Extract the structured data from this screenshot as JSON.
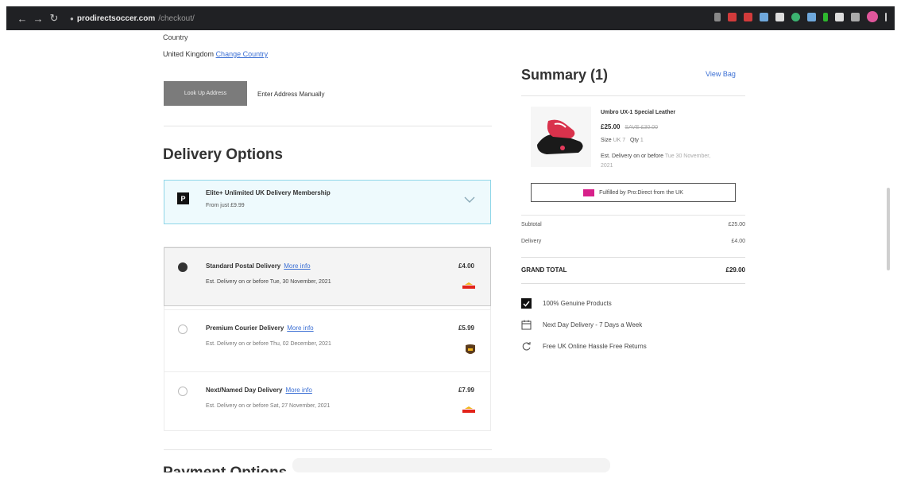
{
  "browser": {
    "url_domain": "prodirectsoccer.com",
    "url_path": "/checkout/"
  },
  "address": {
    "country_label": "Country",
    "country_value": "United Kingdom",
    "change_country": "Change Country",
    "lookup_button": "Look Up Address",
    "manual_link": "Enter Address Manually"
  },
  "delivery": {
    "title": "Delivery Options",
    "elite": {
      "title": "Elite+ Unlimited UK Delivery Membership",
      "subtitle": "From just £9.99"
    },
    "options": [
      {
        "name": "Standard Postal Delivery",
        "more_info": "More info",
        "estimate": "Est. Delivery on or before Tue, 30 November, 2021",
        "price": "£4.00",
        "selected": true,
        "carrier_icon": "royal-mail-icon"
      },
      {
        "name": "Premium Courier Delivery",
        "more_info": "More info",
        "estimate": "Est. Delivery on or before Thu, 02 December, 2021",
        "price": "£5.99",
        "selected": false,
        "carrier_icon": "ups-icon"
      },
      {
        "name": "Next/Named Day Delivery",
        "more_info": "More info",
        "estimate": "Est. Delivery on or before Sat, 27 November, 2021",
        "price": "£7.99",
        "selected": false,
        "carrier_icon": "royal-mail-icon"
      }
    ]
  },
  "payment": {
    "title": "Payment Options"
  },
  "summary": {
    "title": "Summary (1)",
    "view_bag": "View Bag",
    "product": {
      "name": "Umbro UX-1 Special Leather",
      "price": "£25.00",
      "was_price": "SAVE £30.00",
      "size_label": "Size",
      "size_value": "UK 7",
      "qty_label": "Qty",
      "qty_value": "1",
      "delivery_label": "Est. Delivery on or before",
      "delivery_value": "Tue 30 November, 2021"
    },
    "fulfilled": "Fulfilled by Pro:Direct from the UK",
    "subtotal_label": "Subtotal",
    "subtotal_value": "£25.00",
    "delivery_label": "Delivery",
    "delivery_value": "£4.00",
    "grand_total_label": "GRAND TOTAL",
    "grand_total_value": "£29.00",
    "perks": [
      {
        "icon": "genuine-icon",
        "text": "100% Genuine Products"
      },
      {
        "icon": "calendar-icon",
        "text": "Next Day Delivery - 7 Days a Week"
      },
      {
        "icon": "returns-icon",
        "text": "Free UK Online Hassle Free Returns"
      }
    ]
  },
  "colors": {
    "accent_link": "#3b6fd4",
    "elite_border": "#8fd6e8",
    "elite_bg": "#eefafd",
    "royal_mail_red": "#e2231a",
    "ups_brown": "#5c3b1c",
    "ups_gold": "#f3b51c"
  }
}
